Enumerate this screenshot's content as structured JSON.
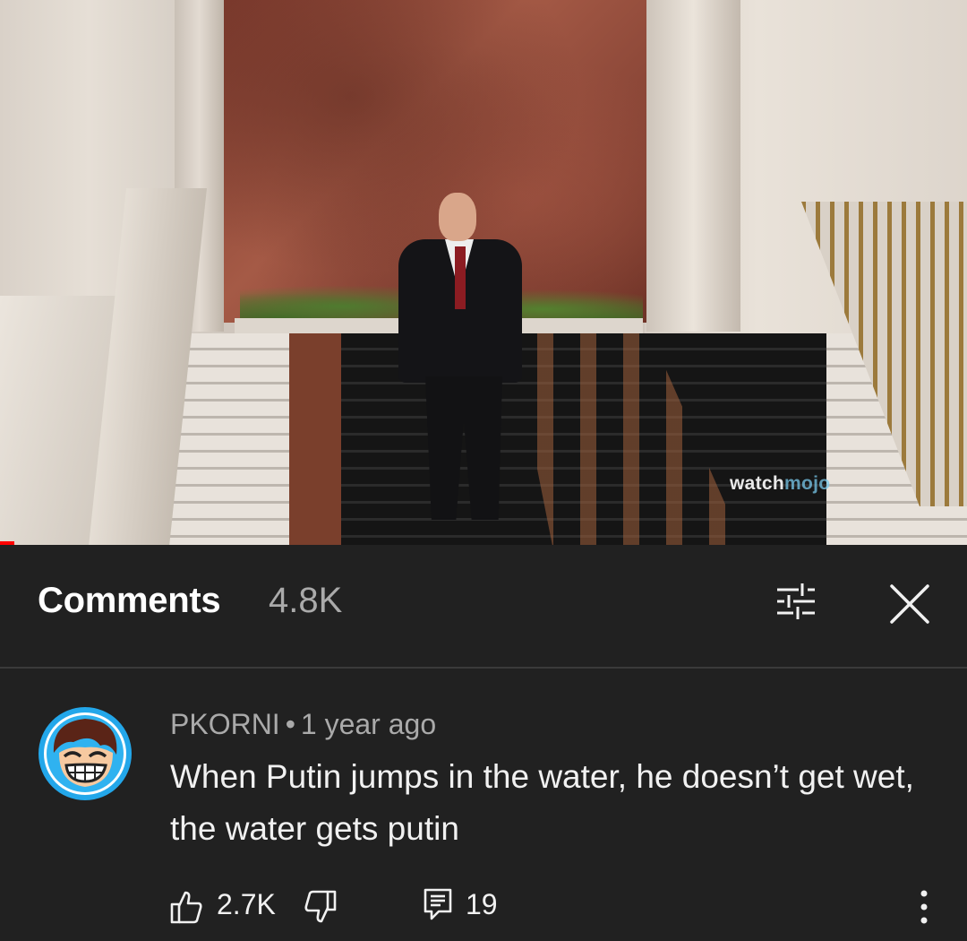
{
  "video": {
    "watermark_part1": "watch",
    "watermark_part2": "mojo",
    "progress_fraction": 0.015
  },
  "comments_panel": {
    "title": "Comments",
    "count": "4.8K",
    "icons": {
      "filter": "sliders-icon",
      "close": "close-icon"
    }
  },
  "comment": {
    "author": "PKORNI",
    "separator": "•",
    "time": "1 year ago",
    "text": "When Putin jumps in the water, he doesn’t get wet, the water gets putin",
    "likes": "2.7K",
    "replies": "19",
    "icons": {
      "like": "thumbs-up-icon",
      "dislike": "thumbs-down-icon",
      "reply": "reply-icon",
      "more": "more-vertical-icon"
    }
  },
  "colors": {
    "background": "#212121",
    "primary_text": "#f1f1f1",
    "secondary_text": "#aaaaaa",
    "progress": "#ff0000"
  }
}
